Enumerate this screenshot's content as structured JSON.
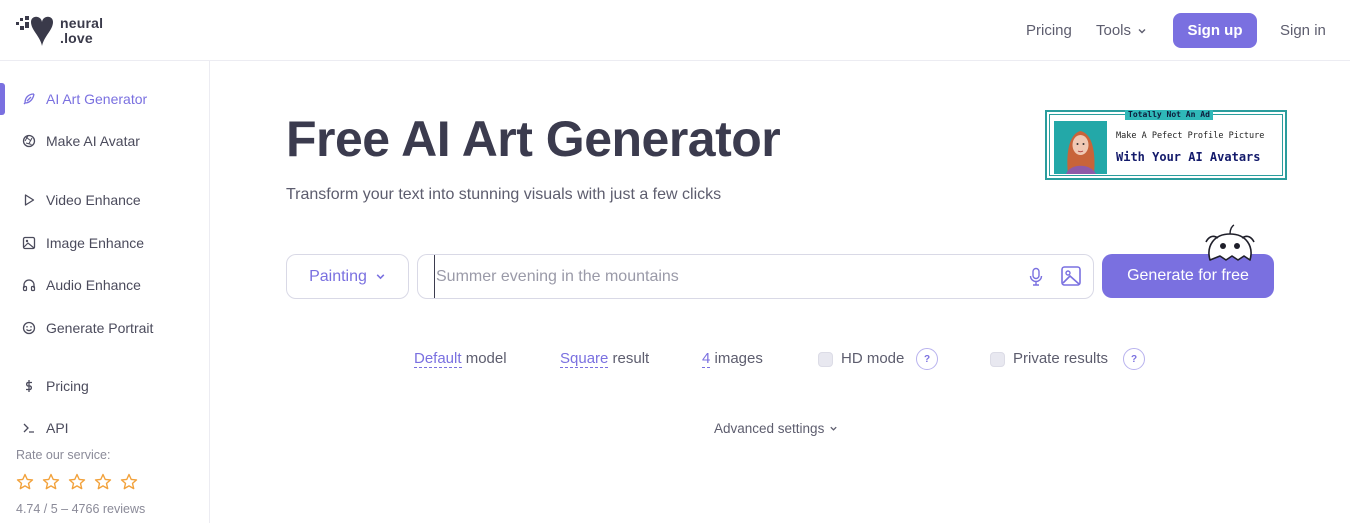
{
  "brand": {
    "name_line1": "neural",
    "name_line2": ".love"
  },
  "nav": {
    "pricing": "Pricing",
    "tools": "Tools",
    "signup": "Sign up",
    "signin": "Sign in"
  },
  "sidebar": {
    "items": [
      {
        "label": "AI Art Generator",
        "icon": "feather-icon",
        "active": true
      },
      {
        "label": "Make AI Avatar",
        "icon": "aperture-icon"
      },
      {
        "label": "Video Enhance",
        "icon": "play-icon"
      },
      {
        "label": "Image Enhance",
        "icon": "image-icon"
      },
      {
        "label": "Audio Enhance",
        "icon": "headphones-icon"
      },
      {
        "label": "Generate Portrait",
        "icon": "smile-icon"
      },
      {
        "label": "Pricing",
        "icon": "dollar-icon"
      },
      {
        "label": "API",
        "icon": "terminal-icon"
      }
    ],
    "rate_label": "Rate our service:",
    "rating_text": "4.74 / 5 – 4766 reviews"
  },
  "main": {
    "title": "Free AI Art Generator",
    "subtitle": "Transform your text into stunning visuals with just a few clicks",
    "style_value": "Painting",
    "prompt_placeholder": "Summer evening in the mountains",
    "generate_label": "Generate for free",
    "options": {
      "model_value": "Default",
      "model_suffix": " model",
      "result_value": "Square",
      "result_suffix": " result",
      "images_value": "4",
      "images_suffix": " images",
      "hd_label": "HD mode",
      "private_label": "Private results",
      "help_glyph": "?"
    },
    "advanced_label": "Advanced settings"
  },
  "ad": {
    "badge": "Totally Not An Ad",
    "line1": "Make A Pefect Profile Picture",
    "line2": "With Your AI Avatars"
  },
  "colors": {
    "accent": "#7a70e0",
    "ad_teal": "#2a9d9d",
    "text_dark": "#3b3b4e"
  }
}
